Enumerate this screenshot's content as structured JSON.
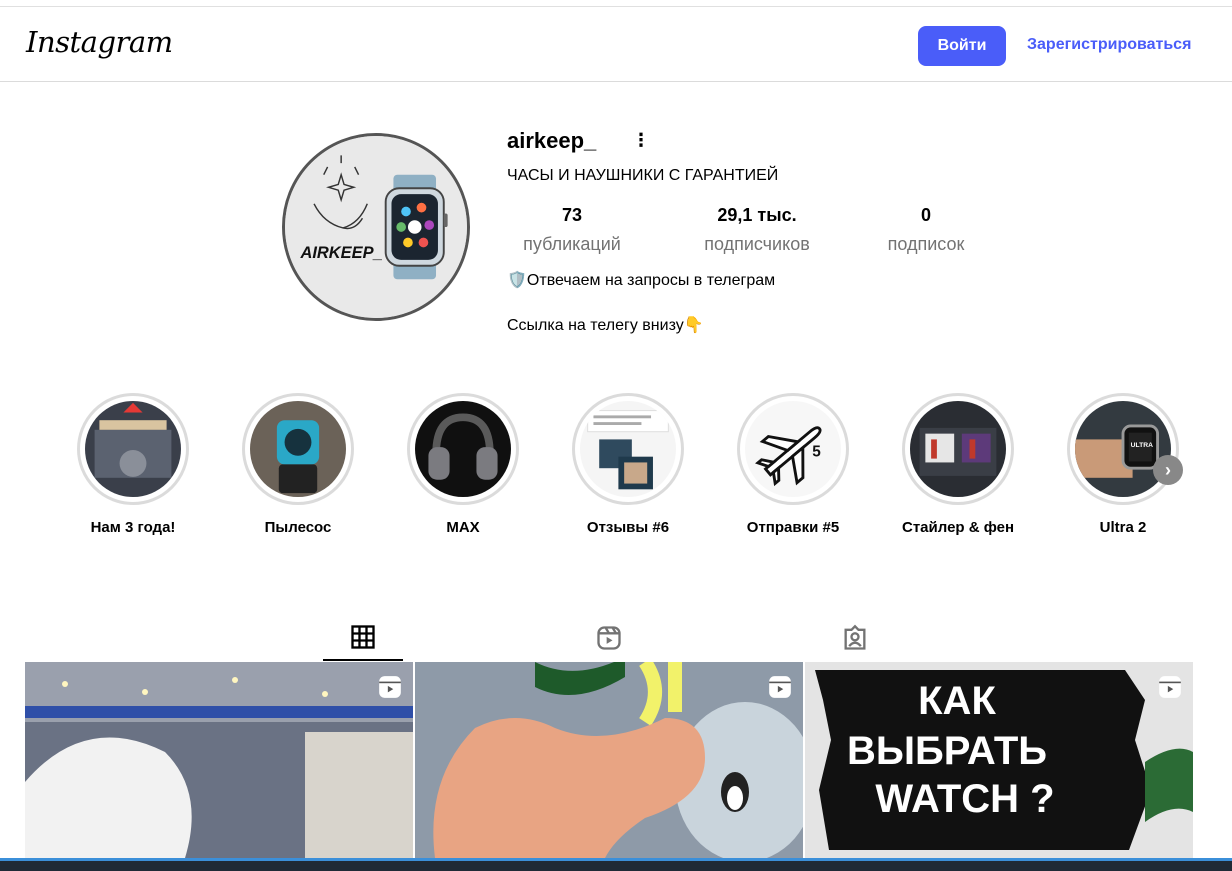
{
  "header": {
    "logo_text": "Instagram",
    "login_label": "Войти",
    "signup_label": "Зарегистрироваться"
  },
  "profile": {
    "username": "airkeep_",
    "avatar_text": "AIRKEEP_",
    "category": "ЧАСЫ И НАУШНИКИ С ГАРАНТИЕЙ",
    "stats": [
      {
        "value": "73",
        "label": "публикаций"
      },
      {
        "value": "29,1 тыс.",
        "label": "подписчиков"
      },
      {
        "value": "0",
        "label": "подписок"
      }
    ],
    "bio": [
      "🛡️Отвечаем на запросы в телеграм",
      "Ссылка на телегу внизу👇"
    ]
  },
  "highlights": [
    {
      "label": "Нам 3 года!"
    },
    {
      "label": "Пылесос"
    },
    {
      "label": "MAX"
    },
    {
      "label": "Отзывы #6"
    },
    {
      "label": "Отправки #5"
    },
    {
      "label": "Стайлер & фен"
    },
    {
      "label": "Ultra 2"
    }
  ],
  "tabs": [
    "grid-icon",
    "reels-icon",
    "tagged-icon"
  ],
  "posts": [
    {
      "overlay_text": ""
    },
    {
      "overlay_text": ""
    },
    {
      "overlay_lines": [
        "КАК",
        "ВЫБРАТЬ",
        "WATCH ?"
      ]
    }
  ],
  "colors": {
    "accent": "#4a5df9",
    "muted": "#737373"
  }
}
